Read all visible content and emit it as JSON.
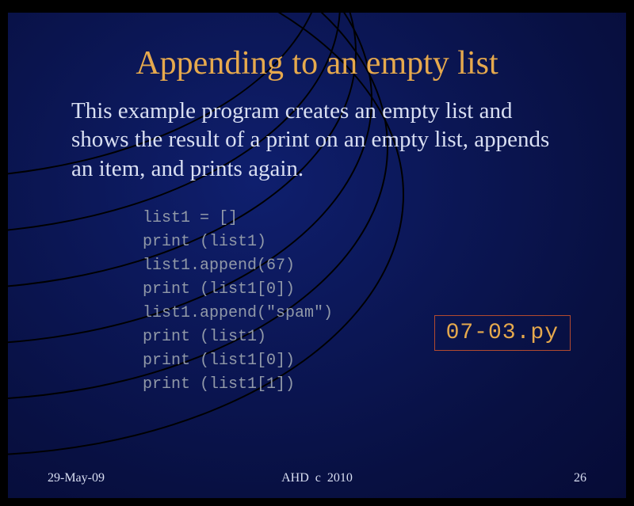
{
  "title": "Appending to an empty list",
  "body": "This example program creates an empty list and shows the result of a print on an empty list, appends an item, and prints again.",
  "code": "list1 = []\nprint (list1)\nlist1.append(67)\nprint (list1[0])\nlist1.append(\"spam\")\nprint (list1)\nprint (list1[0])\nprint (list1[1])",
  "filename": "07-03.py",
  "footer": {
    "date": "29-May-09",
    "copyright": "AHD  c  2010",
    "page": "26"
  }
}
